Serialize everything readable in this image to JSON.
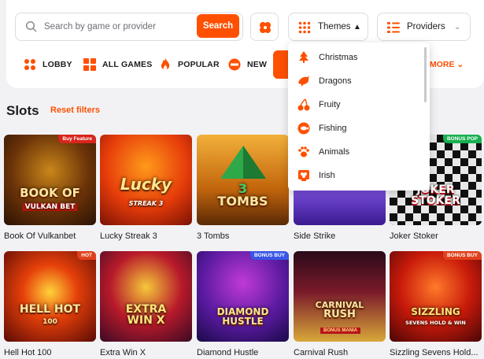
{
  "search": {
    "placeholder": "Search by game or provider",
    "button": "Search"
  },
  "filters": {
    "themes_label": "Themes",
    "providers_label": "Providers"
  },
  "nav": {
    "items": [
      {
        "label": "LOBBY",
        "icon": "grid-dots-icon"
      },
      {
        "label": "ALL GAMES",
        "icon": "grid-squares-icon"
      },
      {
        "label": "POPULAR",
        "icon": "flame-icon"
      },
      {
        "label": "NEW",
        "icon": "new-badge-icon"
      }
    ],
    "more": "MORE"
  },
  "themes_dropdown": {
    "items": [
      {
        "label": "Christmas",
        "icon": "christmas-tree-icon"
      },
      {
        "label": "Dragons",
        "icon": "dragon-icon"
      },
      {
        "label": "Fruity",
        "icon": "cherries-icon"
      },
      {
        "label": "Fishing",
        "icon": "fish-icon"
      },
      {
        "label": "Animals",
        "icon": "paw-icon"
      },
      {
        "label": "Irish",
        "icon": "shamrock-icon"
      }
    ]
  },
  "section": {
    "title": "Slots",
    "reset": "Reset filters"
  },
  "games": [
    {
      "name": "Book Of Vulkanbet",
      "logo": "BOOK OF",
      "sub": "VULKAN BET",
      "badge": "Buy Feature"
    },
    {
      "name": "Lucky Streak 3",
      "logo": "Lucky",
      "sub": "STREAK 3",
      "badge": ""
    },
    {
      "name": "3 Tombs",
      "logo": "3",
      "sub": "TOMBS",
      "badge": ""
    },
    {
      "name": "Side Strike",
      "logo": "",
      "sub": "",
      "badge": ""
    },
    {
      "name": "Joker Stoker",
      "logo": "JOKER",
      "sub": "STOKER",
      "badge": "BONUS POP"
    },
    {
      "name": "Hell Hot 100",
      "logo": "HELL HOT",
      "sub": "100",
      "badge": "HOT"
    },
    {
      "name": "Extra Win X",
      "logo": "EXTRA",
      "sub": "WIN X",
      "badge": ""
    },
    {
      "name": "Diamond Hustle",
      "logo": "DIAMOND",
      "sub": "HUSTLE",
      "badge": "BONUS BUY"
    },
    {
      "name": "Carnival Rush",
      "logo": "CARNIVAL",
      "sub": "RUSH",
      "badge": "BONUS MANIA"
    },
    {
      "name": "Sizzling Sevens Hold...",
      "logo": "SIZZLING",
      "sub": "SEVENS HOLD & WIN",
      "badge": "BONUS BUY"
    }
  ]
}
